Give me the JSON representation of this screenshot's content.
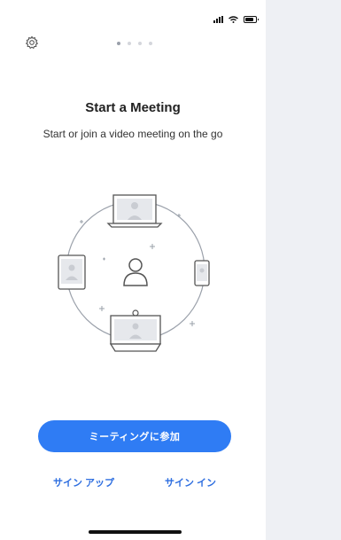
{
  "status": {
    "icons": [
      "signal-icon",
      "wifi-icon",
      "battery-icon"
    ]
  },
  "header": {
    "settings_icon": "gear-icon",
    "page_indicator": {
      "total": 4,
      "active": 1
    }
  },
  "onboarding": {
    "title": "Start a Meeting",
    "subtitle": "Start or join a video meeting on the go",
    "illustration_icon": "video-meeting-devices-icon"
  },
  "actions": {
    "join_meeting": "ミーティングに参加",
    "sign_up": "サイン アップ",
    "sign_in": "サイン イン"
  },
  "colors": {
    "accent": "#2f7cf4",
    "link": "#2f6fe0",
    "background": "#ffffff",
    "outer": "#eef0f4"
  }
}
